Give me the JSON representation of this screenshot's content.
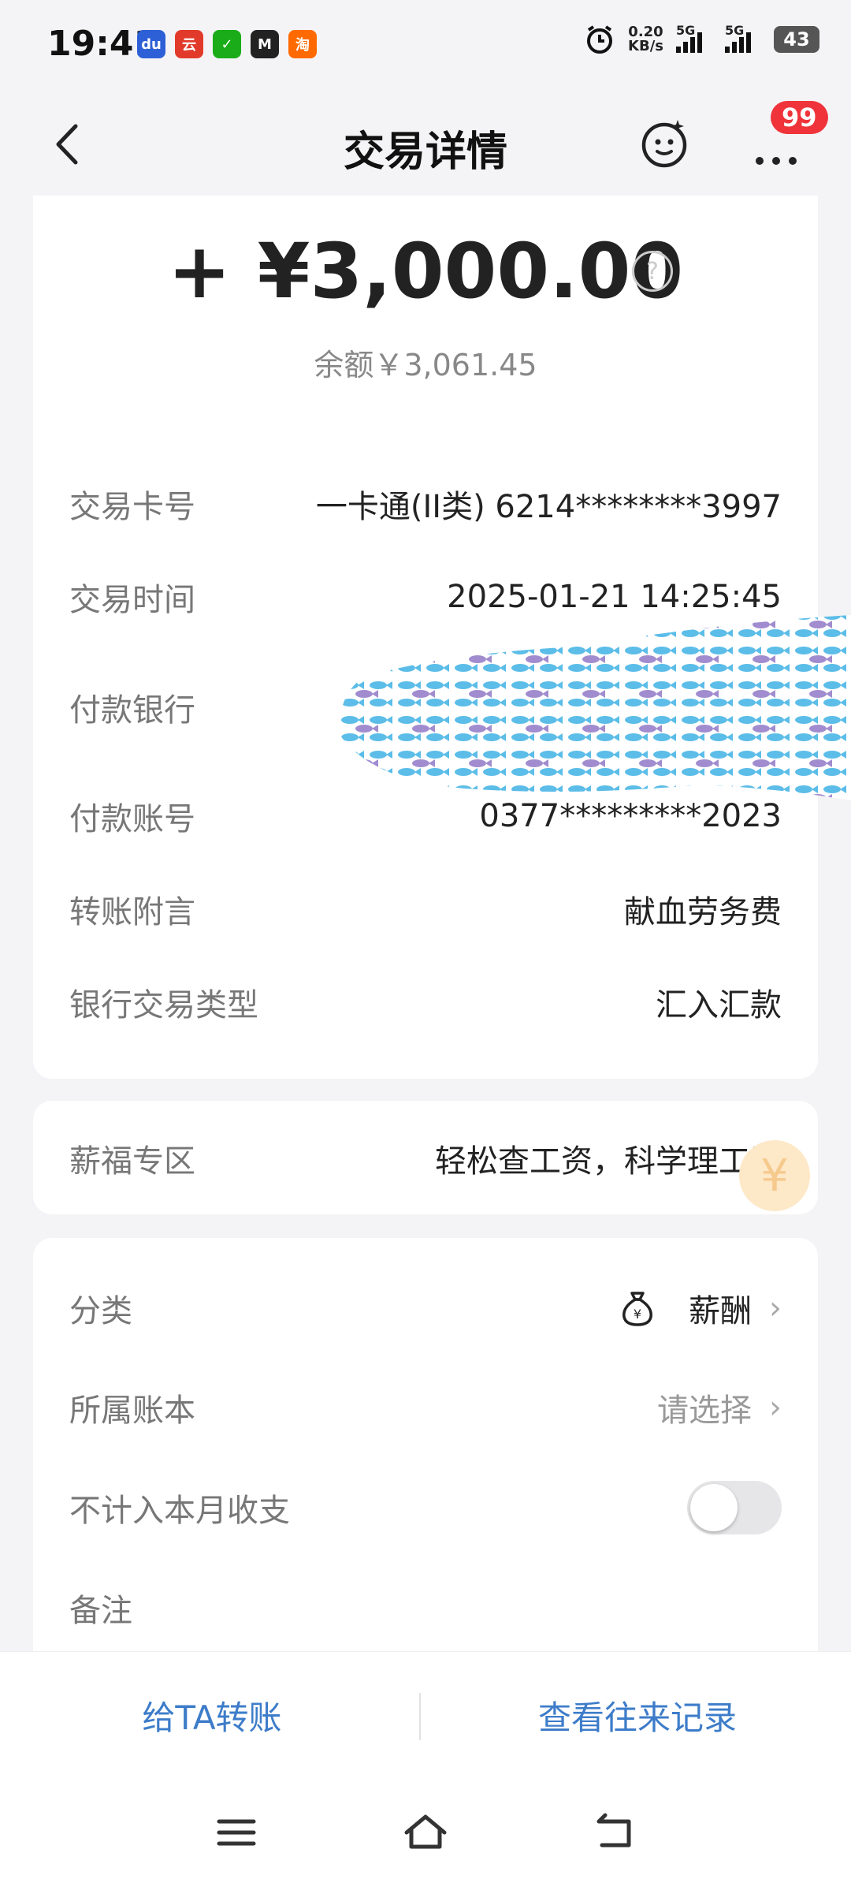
{
  "status_bar": {
    "time": "19:41",
    "apps": [
      {
        "icon": "baidu-icon",
        "text": "du",
        "color": "#2d5fd6"
      },
      {
        "icon": "yunshanfu-icon",
        "text": "云",
        "color": "#e23a2a"
      },
      {
        "icon": "wechat-icon",
        "text": "✓",
        "color": "#1aad19"
      },
      {
        "icon": "moji-weather-icon",
        "text": "M",
        "color": "#222222"
      },
      {
        "icon": "taobao-icon",
        "text": "淘",
        "color": "#ff6a00"
      }
    ],
    "net_speed": "0.20",
    "net_unit": "KB/s",
    "signal1": "5G",
    "signal2": "5G",
    "battery": "43"
  },
  "nav": {
    "title": "交易详情",
    "badge": "99"
  },
  "transaction": {
    "amount": "+ ¥3,000.00",
    "balance": "余额￥3,061.45",
    "details": [
      {
        "label": "交易卡号",
        "value": "一卡通(II类) 6214********3997"
      },
      {
        "label": "交易时间",
        "value": "2025-01-21 14:25:45"
      },
      {
        "label": "付款银行",
        "value": ""
      },
      {
        "label": "付款账号",
        "value": "0377*********2023"
      },
      {
        "label": "转账附言",
        "value": "献血劳务费"
      },
      {
        "label": "银行交易类型",
        "value": "汇入汇款"
      }
    ]
  },
  "salary_zone": {
    "label": "薪福专区",
    "value": "轻松查工资，科学理工资"
  },
  "settings": {
    "category_label": "分类",
    "category_value": "薪酬",
    "ledger_label": "所属账本",
    "ledger_value": "请选择",
    "exclude_label": "不计入本月收支",
    "exclude_on": false,
    "note_label": "备注"
  },
  "bottom_actions": {
    "transfer": "给TA转账",
    "history": "查看往来记录"
  },
  "colors": {
    "accent": "#3d7cc9",
    "badge": "#f0333a"
  }
}
